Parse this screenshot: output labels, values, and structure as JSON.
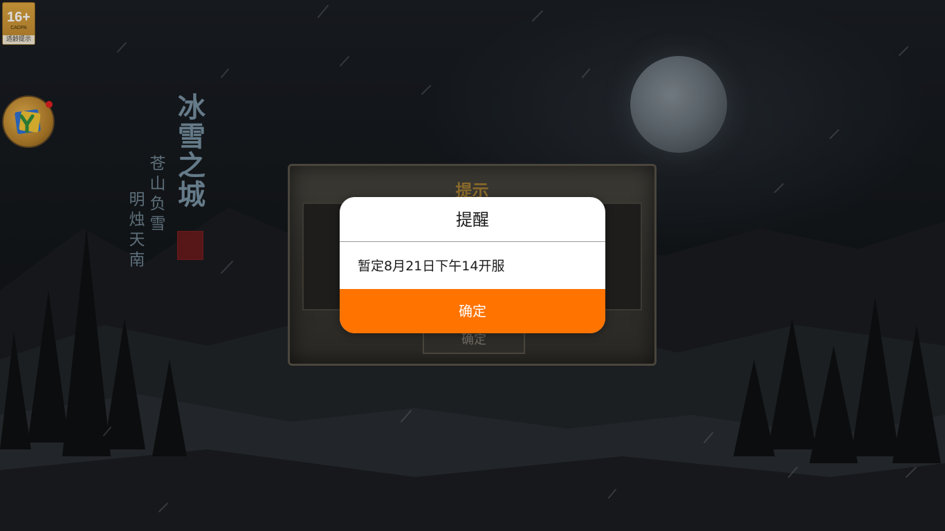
{
  "age_badge": {
    "rating": "16+",
    "org": "CADPA",
    "tip": "适龄提示"
  },
  "logo": {
    "title": "冰雪之城",
    "line_a": "苍山负雪",
    "line_b": "明烛天南"
  },
  "game_dialog": {
    "title": "提示",
    "confirm_label": "确定"
  },
  "alert": {
    "title": "提醒",
    "message": "暂定8月21日下午14开服",
    "confirm_label": "确定"
  },
  "colors": {
    "alert_button": "#ff7300",
    "alert_background": "#ffffff",
    "game_title_gold": "#8a6a2a"
  },
  "icons": {
    "floating_app": "app-logo-icon",
    "notification": "red-dot-icon",
    "moon": "moon"
  }
}
